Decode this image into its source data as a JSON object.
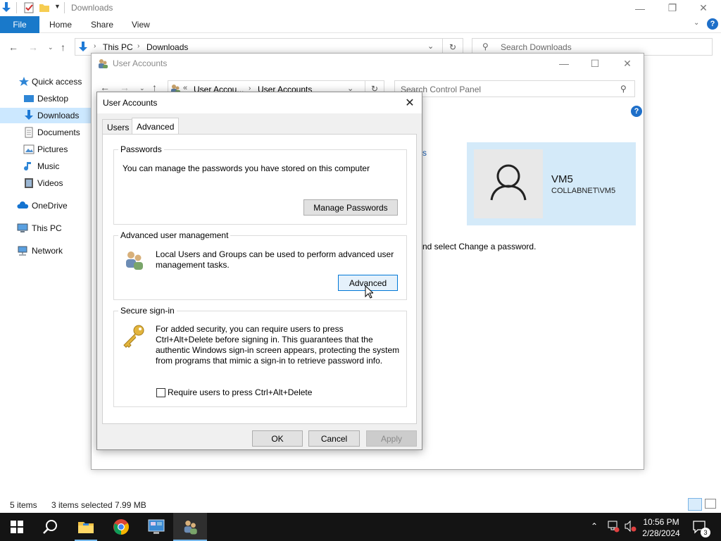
{
  "explorer": {
    "title": "Downloads",
    "ribbon_tabs": {
      "file": "File",
      "home": "Home",
      "share": "Share",
      "view": "View"
    },
    "breadcrumb": [
      "This PC",
      "Downloads"
    ],
    "search_placeholder": "Search Downloads",
    "nav": {
      "quick_access": "Quick access",
      "desktop": "Desktop",
      "downloads": "Downloads",
      "documents": "Documents",
      "pictures": "Pictures",
      "music": "Music",
      "videos": "Videos",
      "onedrive": "OneDrive",
      "this_pc": "This PC",
      "network": "Network"
    },
    "status": {
      "items": "5 items",
      "selected": "3 items selected  7.99 MB"
    }
  },
  "control_panel": {
    "title": "User Accounts",
    "breadcrumb": [
      "User Accou...",
      "User Accounts"
    ],
    "search_placeholder": "Search Control Panel",
    "help": "?",
    "partial_link": "s",
    "partial_text": "nd select Change a password.",
    "user": {
      "name": "VM5",
      "domain": "COLLABNET\\VM5"
    }
  },
  "dialog": {
    "title": "User Accounts",
    "tabs": {
      "users": "Users",
      "advanced": "Advanced"
    },
    "passwords": {
      "label": "Passwords",
      "text": "You can manage the passwords you have stored on this computer",
      "button": "Manage Passwords"
    },
    "advanced_mgmt": {
      "label": "Advanced user management",
      "text": "Local Users and Groups can be used to perform advanced user management tasks.",
      "button": "Advanced"
    },
    "secure_signin": {
      "label": "Secure sign-in",
      "text": "For added security, you can require users to press Ctrl+Alt+Delete before signing in. This guarantees that the authentic Windows sign-in screen appears, protecting the system from programs that mimic a sign-in to retrieve password info.",
      "checkbox": "Require users to press Ctrl+Alt+Delete",
      "checked": false
    },
    "buttons": {
      "ok": "OK",
      "cancel": "Cancel",
      "apply": "Apply"
    }
  },
  "taskbar": {
    "time": "10:56 PM",
    "date": "2/28/2024",
    "notifications": "3"
  },
  "colors": {
    "accent": "#1979ca",
    "selection": "#cce8ff",
    "taskbar": "#141414"
  }
}
